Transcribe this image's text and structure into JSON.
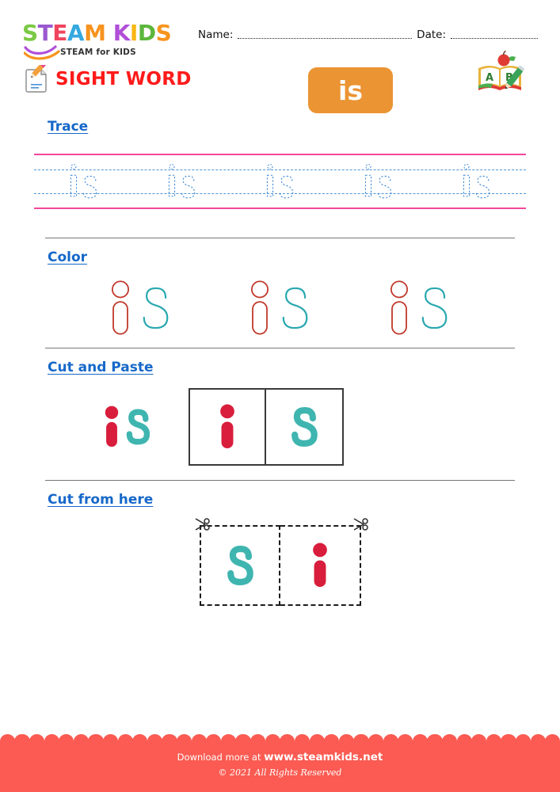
{
  "brand": {
    "logo_letters": [
      {
        "ch": "S",
        "color": "#7ac943"
      },
      {
        "ch": "T",
        "color": "#9b59d0"
      },
      {
        "ch": "E",
        "color": "#f0445e"
      },
      {
        "ch": "A",
        "color": "#35a8e0"
      },
      {
        "ch": "M",
        "color": "#f7931e"
      },
      {
        "ch": " ",
        "color": "#ffffff"
      },
      {
        "ch": "K",
        "color": "#b04fd8"
      },
      {
        "ch": "I",
        "color": "#fbb615"
      },
      {
        "ch": "D",
        "color": "#5cb63c"
      },
      {
        "ch": "S",
        "color": "#f7941e"
      }
    ],
    "logo_tagline": "STEAM for KIDS"
  },
  "header": {
    "name_label": "Name:",
    "date_label": "Date:",
    "title": "SIGHT WORD",
    "title_color": "#ff1a1a",
    "pencil_icon": "pencil-paper-icon",
    "book_icon": "abc-book-apple-pencil-icon",
    "book_letters": [
      "A",
      "B"
    ],
    "badge_word": "is",
    "badge_color": "#eb9433",
    "badge_text_color": "#ffffff"
  },
  "sections": {
    "trace": {
      "label": "Trace",
      "word": "is",
      "repeats": 5,
      "line_color_solid": "#f2479a",
      "line_color_dashed": "#4f94d4",
      "letter_color": "#3d87d6"
    },
    "color": {
      "label": "Color",
      "word": "is",
      "repeats": 3,
      "i_color": "#c0392b",
      "s_color": "#2aa8b0"
    },
    "cut_and_paste": {
      "label": "Cut and Paste",
      "sample_word": "is",
      "boxes": [
        "i",
        "s"
      ],
      "i_color": "#d81e3c",
      "s_color": "#3fb5b0",
      "box_border_color": "#3a3a3a"
    },
    "cut_from_here": {
      "label": "Cut from here",
      "boxes": [
        "s",
        "i"
      ],
      "i_color": "#d81e3c",
      "s_color": "#3fb5b0",
      "scissors_icon": "scissors-icon",
      "box_border_color": "#1c1c1c"
    }
  },
  "section_label_color": "#1668c9",
  "footer": {
    "download_prefix": "Download more at",
    "site": "www.steamkids.net",
    "copyright": "© 2021 All Rights Reserved",
    "background": "#fb5b52"
  }
}
